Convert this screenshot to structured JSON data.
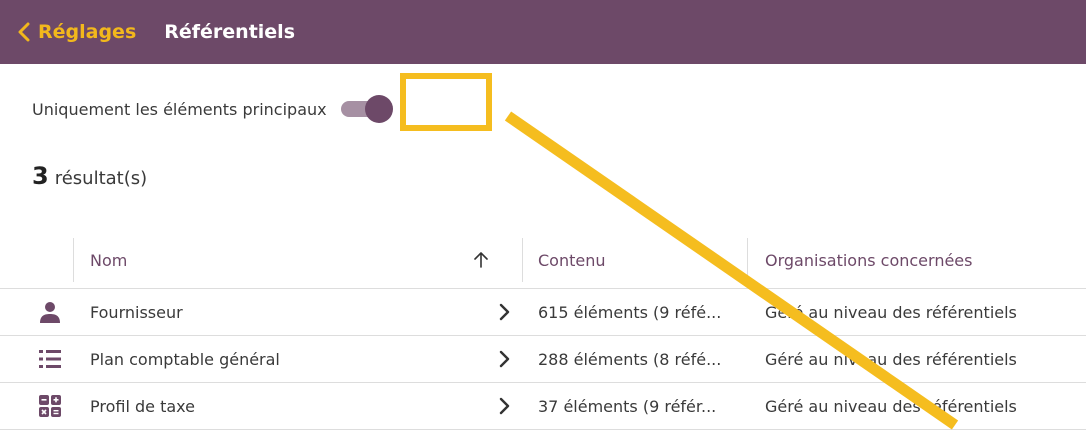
{
  "header": {
    "back_label": "Réglages",
    "title": "Référentiels"
  },
  "filter": {
    "label": "Uniquement les éléments principaux",
    "toggle_on": true
  },
  "results": {
    "count": "3",
    "label": "résultat(s)"
  },
  "table": {
    "columns": {
      "name": "Nom",
      "content": "Contenu",
      "organisations": "Organisations concernées"
    },
    "sort": "ascending",
    "rows": [
      {
        "icon": "person-icon",
        "name": "Fournisseur",
        "content": "615 éléments (9 réfé...",
        "organisations": "Géré au niveau des référentiels"
      },
      {
        "icon": "list-icon",
        "name": "Plan comptable général",
        "content": "288 éléments (8 réfé...",
        "organisations": "Géré au niveau des référentiels"
      },
      {
        "icon": "calculator-icon",
        "name": "Profil de taxe",
        "content": "37 éléments (9 référ...",
        "organisations": "Géré au niveau des référentiels"
      }
    ]
  },
  "colors": {
    "header_bg": "#6d4968",
    "accent": "#f2b81c",
    "primary": "#6d4968",
    "highlight": "#f5bd1f"
  }
}
